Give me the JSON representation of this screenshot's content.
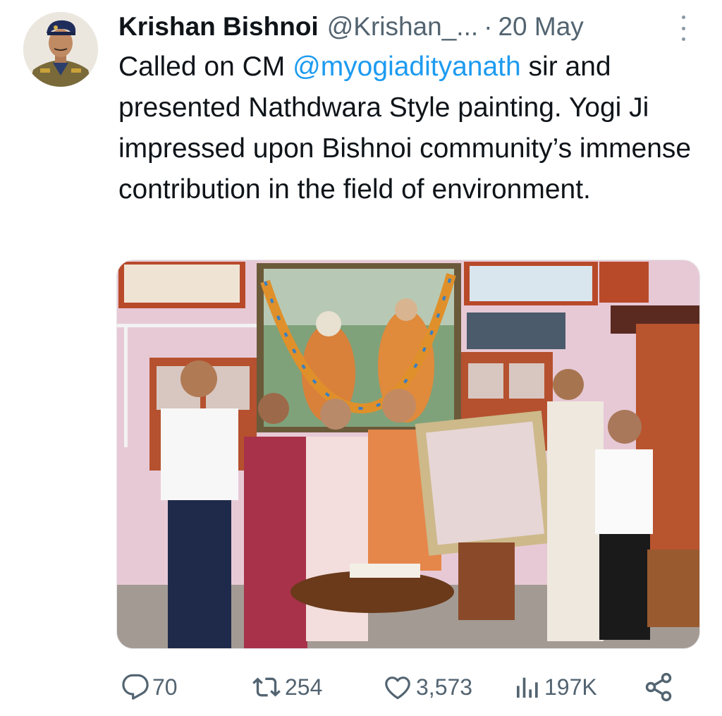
{
  "tweet": {
    "author_name": "Krishan Bishnoi",
    "handle": "@Krishan_...",
    "separator": "·",
    "date": "20 May",
    "text_before": "Called on CM ",
    "mention": "@myogiadityanath",
    "text_after": " sir and presented Nathdwara Style painting. Yogi Ji impressed upon Bishnoi community’s immense  contribution in the field of environment."
  },
  "actions": {
    "replies": "70",
    "reposts": "254",
    "likes": "3,573",
    "views": "197K"
  },
  "icons": {
    "reply": "reply-icon",
    "repost": "repost-icon",
    "like": "heart-icon",
    "views": "views-icon",
    "share": "share-icon",
    "more": "more-icon"
  },
  "colors": {
    "mention": "#1d9bf0",
    "text": "#0f1419",
    "secondary": "#536471"
  }
}
